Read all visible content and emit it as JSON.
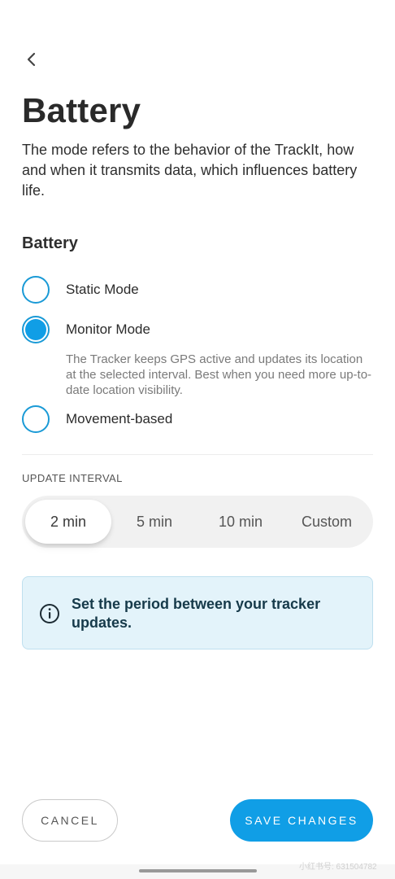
{
  "header": {
    "back_icon": "chevron-left-icon",
    "title": "Battery",
    "description": "The mode refers to the behavior of the TrackIt, how and when it transmits data, which influences battery life."
  },
  "battery_section": {
    "heading": "Battery",
    "options": [
      {
        "label": "Static Mode",
        "selected": false
      },
      {
        "label": "Monitor Mode",
        "selected": true
      },
      {
        "label": "Movement-based",
        "selected": false
      }
    ],
    "selected_description": "The Tracker keeps GPS active and updates its location at the selected interval. Best when you need more up-to-date location visibility."
  },
  "update_interval": {
    "label": "UPDATE  INTERVAL",
    "options": [
      "2 min",
      "5 min",
      "10 min",
      "Custom"
    ],
    "selected": "2 min"
  },
  "info": {
    "icon": "info-icon",
    "text": "Set the period between your tracker updates."
  },
  "actions": {
    "cancel_label": "CANCEL",
    "save_label": "SAVE CHANGES"
  },
  "watermark": "小红书号: 631504782",
  "colors": {
    "accent": "#109ee6",
    "info_bg": "#e3f3fa",
    "info_text": "#163a4a"
  }
}
